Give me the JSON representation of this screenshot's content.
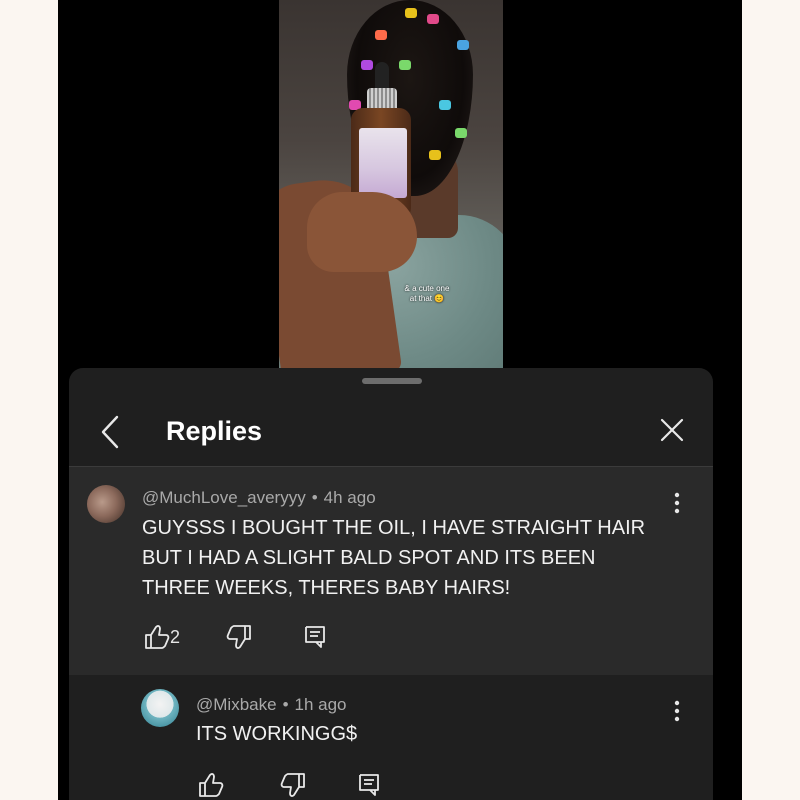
{
  "video": {
    "caption_line1": "& a cute one",
    "caption_line2": "at that 😊"
  },
  "replies_panel": {
    "title": "Replies",
    "back_icon": "chevron-left-icon",
    "close_icon": "close-icon"
  },
  "parent_comment": {
    "author": "@MuchLove_averyyy",
    "time": "4h ago",
    "text_line1": "GUYSSS I BOUGHT THE OIL, I HAVE STRAIGHT HAIR",
    "text_line2": "BUT I HAD A SLIGHT BALD SPOT AND ITS BEEN",
    "text_line3": "THREE WEEKS, THERES BABY HAIRS!",
    "likes": "2"
  },
  "reply": {
    "author": "@Mixbake",
    "time": "1h ago",
    "text": "ITS WORKINGG$"
  },
  "meta_separator": "•",
  "colors": {
    "sheet_bg": "#1f1f1f",
    "highlight_bg": "#2a2a2a",
    "text": "#f1f1f1",
    "meta": "#a9a9a9"
  }
}
